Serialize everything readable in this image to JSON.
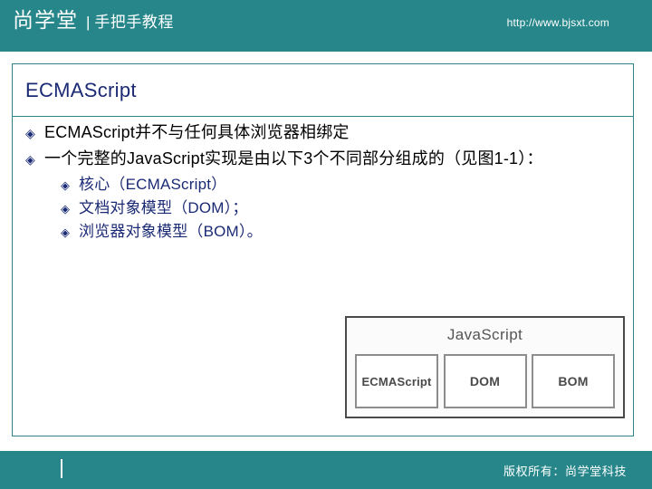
{
  "header": {
    "brand": "尚学堂",
    "divider": "|",
    "subtitle": "手把手教程",
    "url": "http://www.bjsxt.com"
  },
  "slide": {
    "title": "ECMAScript",
    "bullet_glyph": "◈",
    "bullets": [
      {
        "level": 1,
        "text": "ECMAScript并不与任何具体浏览器相绑定"
      },
      {
        "level": 1,
        "text": "一个完整的JavaScript实现是由以下3个不同部分组成的（见图1-1）："
      },
      {
        "level": 2,
        "text": "核心（ECMAScript）"
      },
      {
        "level": 2,
        "text": "文档对象模型（DOM）；"
      },
      {
        "level": 2,
        "text": "浏览器对象模型（BOM）。"
      }
    ]
  },
  "figure": {
    "title": "JavaScript",
    "boxes": [
      {
        "label": "ECMAScript"
      },
      {
        "label": "DOM"
      },
      {
        "label": "BOM"
      }
    ]
  },
  "footer": {
    "copyright": "版权所有：尚学堂科技"
  },
  "colors": {
    "teal_band": "#26868a",
    "panel_border": "#2e8387",
    "title_navy": "#1b2a74",
    "body_black": "#000000",
    "figure_border": "#4a4a4a"
  }
}
